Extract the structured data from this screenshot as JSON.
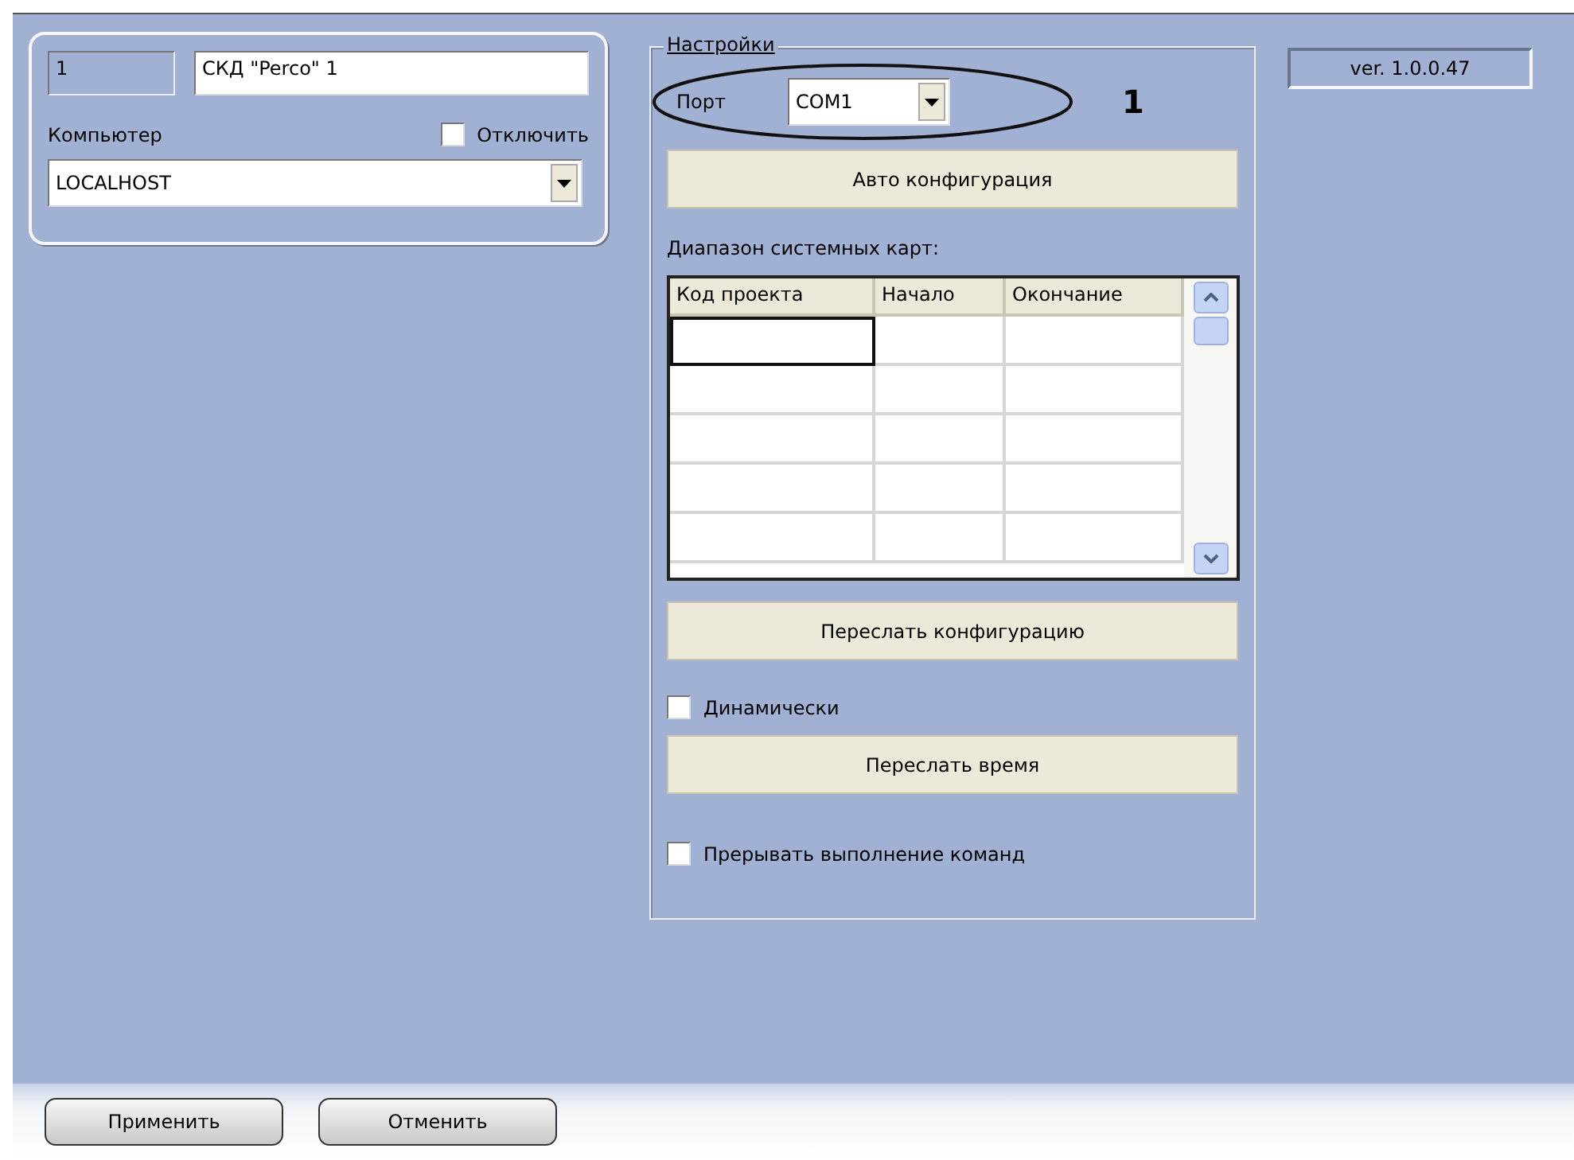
{
  "object": {
    "id": "1",
    "name": "СКД \"Perco\" 1",
    "computer_label": "Компьютер",
    "disable": {
      "label": "Отключить",
      "checked": false
    },
    "computer": "LOCALHOST"
  },
  "settings": {
    "title": "Настройки",
    "port_label": "Порт",
    "port": "COM1",
    "callout": "1",
    "auto_config": "Авто конфигурация",
    "range_label": "Диапазон системных карт:",
    "table": {
      "columns": [
        "Код проекта",
        "Начало",
        "Окончание"
      ]
    },
    "send_config": "Переслать конфигурацию",
    "dynamic": {
      "label": "Динамически",
      "checked": false
    },
    "send_time": "Переслать время",
    "interrupt": {
      "label": "Прерывать выполнение команд",
      "checked": false
    }
  },
  "version": "ver. 1.0.0.47",
  "buttons": [
    "Применить",
    "Отменить"
  ]
}
